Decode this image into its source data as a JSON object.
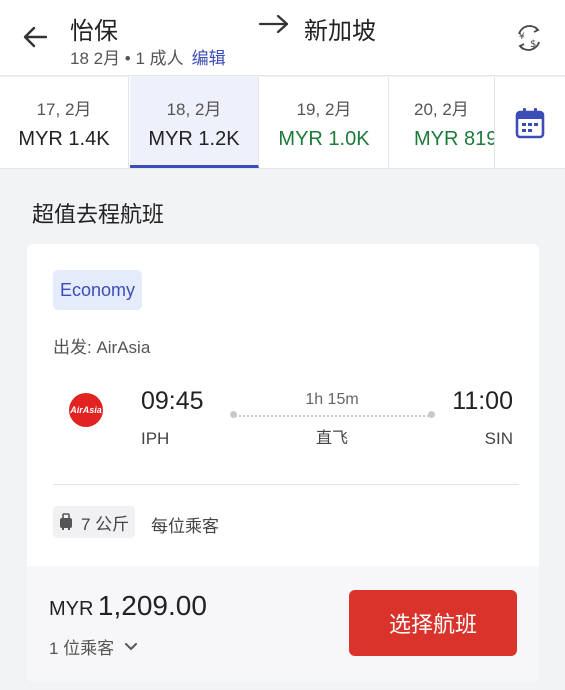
{
  "header": {
    "origin": "怡保",
    "destination": "新加坡",
    "trip_summary": "18 2月 • 1 成人",
    "edit_label": "编辑"
  },
  "date_tabs": [
    {
      "date": "17, 2月",
      "price": "MYR 1.4K",
      "selected": false,
      "cheap": false
    },
    {
      "date": "18, 2月",
      "price": "MYR 1.2K",
      "selected": true,
      "cheap": false
    },
    {
      "date": "19, 2月",
      "price": "MYR 1.0K",
      "selected": false,
      "cheap": true
    },
    {
      "date": "20, 2月",
      "price": "MYR 819",
      "selected": false,
      "cheap": true
    }
  ],
  "section_title": "超值去程航班",
  "flight": {
    "cabin": "Economy",
    "operator": "出发: AirAsia",
    "logo_text": "AirAsia",
    "departure_time": "09:45",
    "departure_code": "IPH",
    "duration": "1h 15m",
    "stops": "直飞",
    "arrival_time": "11:00",
    "arrival_code": "SIN",
    "baggage_weight": "7 公斤",
    "baggage_note": "每位乘客"
  },
  "footer": {
    "currency": "MYR",
    "amount": "1,209.00",
    "passengers": "1 位乘客",
    "select_label": "选择航班"
  },
  "colors": {
    "accent": "#3d4db8",
    "cheap": "#1e7a3a",
    "cta": "#d9332b",
    "airasia": "#e32222"
  },
  "icons": {
    "back": "arrow-left-icon",
    "route": "arrow-right-icon",
    "currency": "currency-switch-icon",
    "calendar": "calendar-icon",
    "baggage": "carry-on-bag-icon",
    "chevron": "chevron-down-icon"
  }
}
